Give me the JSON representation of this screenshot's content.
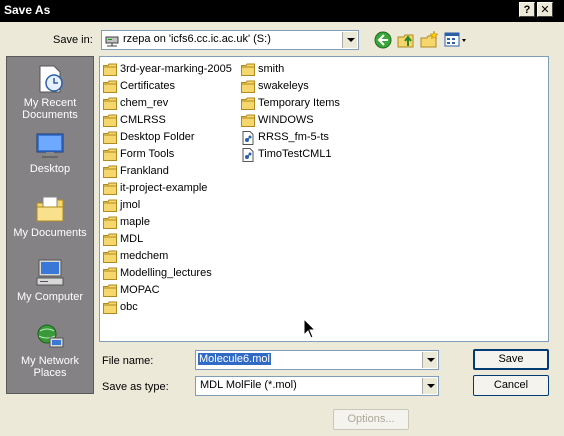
{
  "window": {
    "title": "Save As",
    "help_label": "?",
    "close_label": "✕"
  },
  "save_in": {
    "label": "Save in:",
    "value": "rzepa on 'icfs6.cc.ic.ac.uk' (S:)"
  },
  "toolbar": {
    "icons": [
      "back-icon",
      "up-folder-icon",
      "new-folder-icon",
      "views-menu-icon"
    ]
  },
  "places": [
    {
      "label": "My Recent Documents",
      "icon": "recent-documents-icon"
    },
    {
      "label": "Desktop",
      "icon": "desktop-icon"
    },
    {
      "label": "My Documents",
      "icon": "my-documents-icon"
    },
    {
      "label": "My Computer",
      "icon": "my-computer-icon"
    },
    {
      "label": "My Network Places",
      "icon": "network-places-icon"
    }
  ],
  "files": {
    "col1": [
      "3rd-year-marking-2005",
      "Certificates",
      "chem_rev",
      "CMLRSS",
      "Desktop Folder",
      "Form Tools",
      "Frankland",
      "it-project-example",
      "jmol",
      "maple",
      "MDL",
      "medchem",
      "Modelling_lectures",
      "MOPAC",
      "obc"
    ],
    "col2": [
      {
        "name": "smith",
        "type": "folder"
      },
      {
        "name": "swakeleys",
        "type": "folder"
      },
      {
        "name": "Temporary Items",
        "type": "folder"
      },
      {
        "name": "WINDOWS",
        "type": "folder"
      },
      {
        "name": "RRSS_fm-5-ts",
        "type": "file"
      },
      {
        "name": "TimoTestCML1",
        "type": "file"
      }
    ]
  },
  "file_name": {
    "label": "File name:",
    "value": "Molecule6.mol"
  },
  "save_as_type": {
    "label": "Save as type:",
    "value": "MDL MolFile (*.mol)"
  },
  "buttons": {
    "save": "Save",
    "cancel": "Cancel",
    "options": "Options..."
  },
  "colors": {
    "selection": "#316ac5",
    "places_bg": "#848284",
    "dialog_bg": "#ece9d8"
  }
}
